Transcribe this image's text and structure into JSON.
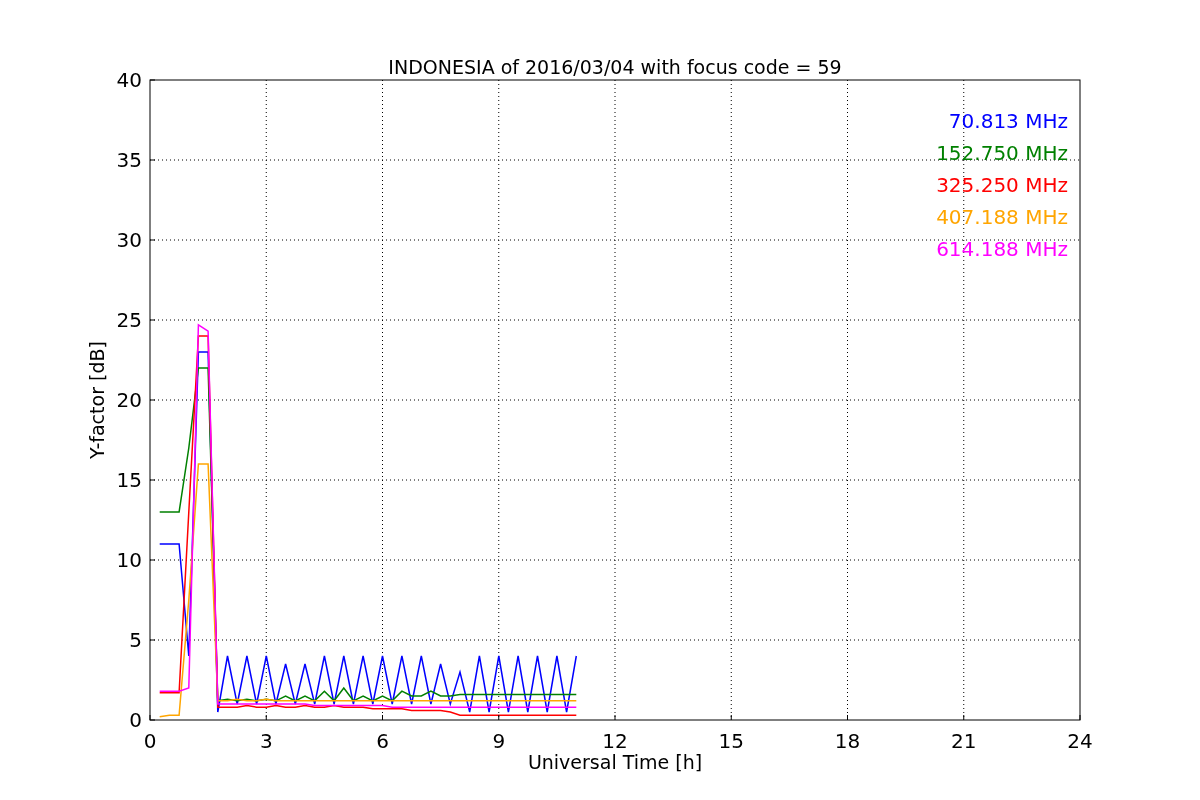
{
  "figure": {
    "chart_data": {
      "type": "line",
      "title": "INDONESIA of 2016/03/04 with focus code = 59",
      "xlabel": "Universal Time [h]",
      "ylabel": "Y-factor [dB]",
      "xlim": [
        0,
        24
      ],
      "ylim": [
        0,
        40
      ],
      "xticks": [
        0,
        3,
        6,
        9,
        12,
        15,
        18,
        21,
        24
      ],
      "yticks": [
        0,
        5,
        10,
        15,
        20,
        25,
        30,
        35,
        40
      ],
      "grid": true,
      "x": [
        0.25,
        0.5,
        0.75,
        1,
        1.25,
        1.5,
        1.75,
        2,
        2.25,
        2.5,
        2.75,
        3,
        3.25,
        3.5,
        3.75,
        4,
        4.25,
        4.5,
        4.75,
        5,
        5.25,
        5.5,
        5.75,
        6,
        6.25,
        6.5,
        6.75,
        7,
        7.25,
        7.5,
        7.75,
        8,
        8.25,
        8.5,
        8.75,
        9,
        9.25,
        9.5,
        9.75,
        10,
        10.25,
        10.5,
        10.75,
        11
      ],
      "series": [
        {
          "name": "70.813 MHz",
          "color": "#0000ff",
          "values": [
            11,
            11,
            11,
            4,
            23,
            23,
            0.5,
            4,
            1,
            4,
            1,
            4,
            1,
            3.5,
            1,
            3.5,
            1,
            4,
            1,
            4,
            1,
            4,
            1,
            4,
            1,
            4,
            1,
            4,
            1,
            3.5,
            1,
            3,
            0.5,
            4,
            0.5,
            4,
            0.5,
            4,
            0.5,
            4,
            0.5,
            4,
            0.5,
            4
          ]
        },
        {
          "name": "152.750 MHz",
          "color": "#008000",
          "values": [
            13,
            13,
            13,
            17,
            22,
            22,
            1.2,
            1.3,
            1.2,
            1.3,
            1.2,
            1.3,
            1.2,
            1.5,
            1.2,
            1.5,
            1.2,
            1.8,
            1.2,
            2,
            1.2,
            1.5,
            1.2,
            1.5,
            1.2,
            1.8,
            1.5,
            1.5,
            1.8,
            1.5,
            1.5,
            1.6,
            1.6,
            1.6,
            1.6,
            1.6,
            1.6,
            1.6,
            1.6,
            1.6,
            1.6,
            1.6,
            1.6,
            1.6
          ]
        },
        {
          "name": "325.250 MHz",
          "color": "#ff0000",
          "values": [
            1.7,
            1.7,
            1.7,
            13,
            24,
            24,
            0.8,
            0.8,
            0.8,
            0.9,
            0.8,
            0.8,
            0.9,
            0.8,
            0.8,
            0.9,
            0.8,
            0.8,
            0.9,
            0.8,
            0.8,
            0.8,
            0.7,
            0.7,
            0.7,
            0.7,
            0.6,
            0.6,
            0.6,
            0.6,
            0.5,
            0.3,
            0.3,
            0.3,
            0.3,
            0.3,
            0.3,
            0.3,
            0.3,
            0.3,
            0.3,
            0.3,
            0.3,
            0.3
          ]
        },
        {
          "name": "407.188 MHz",
          "color": "#ffa500",
          "values": [
            0.2,
            0.3,
            0.3,
            7.5,
            16,
            16,
            1.2,
            1.2,
            1.3,
            1.2,
            1.2,
            1.3,
            1.2,
            1.2,
            1.2,
            1.2,
            1.2,
            1.2,
            1.2,
            1.2,
            1.2,
            1.2,
            1.2,
            1.2,
            1.2,
            1.2,
            1.2,
            1.2,
            1.2,
            1.2,
            1.2,
            1.2,
            1.2,
            1.2,
            1.2,
            1.2,
            1.2,
            1.2,
            1.2,
            1.2,
            1.2,
            1.2,
            1.2,
            1.2
          ]
        },
        {
          "name": "614.188 MHz",
          "color": "#ff00ff",
          "values": [
            1.8,
            1.8,
            1.8,
            2,
            24.7,
            24.3,
            1,
            1,
            1,
            1,
            1,
            1,
            1,
            1,
            1,
            1,
            0.9,
            0.9,
            0.9,
            0.9,
            0.9,
            0.9,
            0.9,
            0.9,
            0.8,
            0.8,
            0.8,
            0.8,
            0.8,
            0.8,
            0.8,
            0.8,
            0.8,
            0.8,
            0.8,
            0.8,
            0.8,
            0.8,
            0.8,
            0.8,
            0.8,
            0.8,
            0.8,
            0.8
          ]
        }
      ]
    }
  }
}
